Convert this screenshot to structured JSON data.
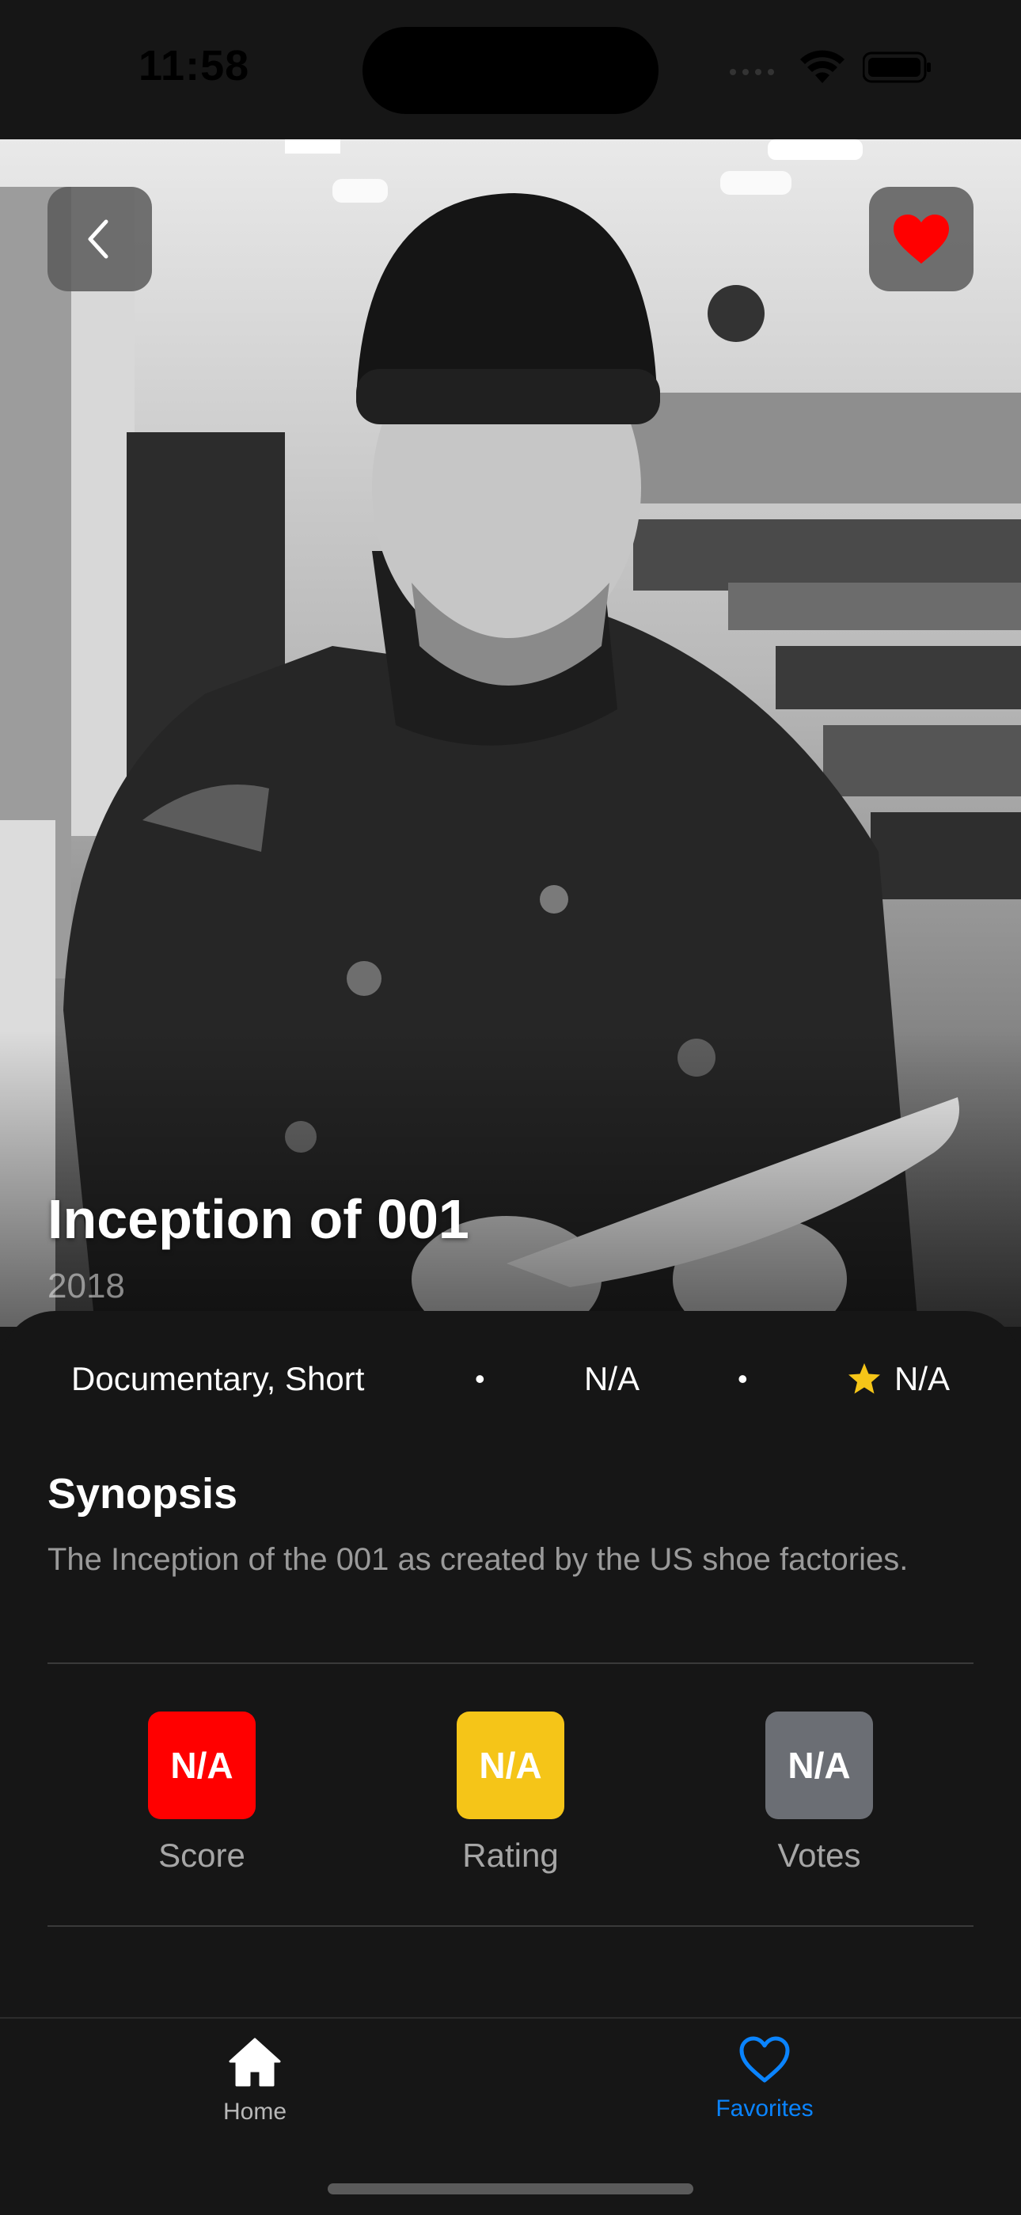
{
  "status_bar": {
    "time": "11:58"
  },
  "movie": {
    "title": "Inception of 001",
    "year": "2018",
    "genres": "Documentary, Short",
    "separator": "•",
    "runtime": "N/A",
    "rating_inline": "N/A"
  },
  "synopsis": {
    "heading": "Synopsis",
    "text": "The Inception of the 001 as created by the US shoe factories."
  },
  "stats": [
    {
      "value": "N/A",
      "label": "Score",
      "color": "#ff0000"
    },
    {
      "value": "N/A",
      "label": "Rating",
      "color": "#f5c518"
    },
    {
      "value": "N/A",
      "label": "Votes",
      "color": "#6b6e74"
    }
  ],
  "tab_bar": {
    "home_label": "Home",
    "favorites_label": "Favorites",
    "active_color": "#0a84ff"
  },
  "icons": {
    "back": "chevron-left-icon",
    "favorite": "heart-filled-icon",
    "star": "star-icon",
    "home": "house-icon",
    "favorites": "heart-outline-icon"
  }
}
